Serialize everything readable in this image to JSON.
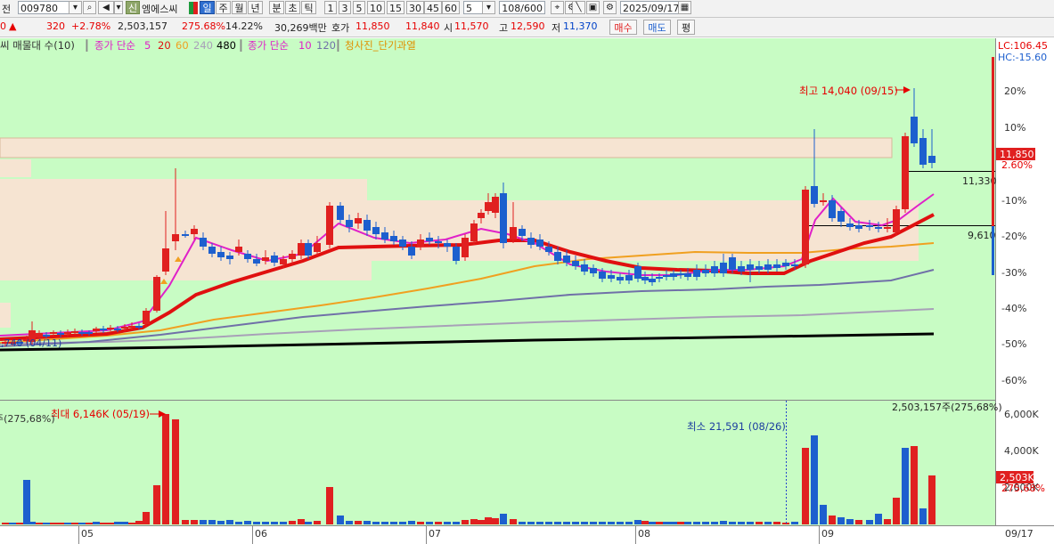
{
  "toolbar": {
    "prefix": "전",
    "code": "009780",
    "credit_badge": "신",
    "stock_name": "엠에스씨",
    "periods": [
      "일",
      "주",
      "월",
      "년",
      "분",
      "초",
      "틱"
    ],
    "selected_period": "일",
    "minute_steps": [
      "1",
      "3",
      "5",
      "10",
      "15",
      "30",
      "45",
      "60"
    ],
    "interval": "5",
    "page_counter": "108/600",
    "date": "2025/09/17"
  },
  "quote": {
    "prefix": "0",
    "down_arrow": "▲",
    "change": "320",
    "change_pct": "+2.78%",
    "volume": "2,503,157",
    "volume_ratio": "275.68%",
    "turnover": "14.22%",
    "trade_value": "30,269백만",
    "ask_label": "호가",
    "ask": "11,850",
    "bid": "11,840",
    "open_label": "시",
    "open": "11,570",
    "high_label": "고",
    "high": "12,590",
    "low_label": "저",
    "low": "11,370",
    "buy_button": "매수",
    "sell_button": "매도",
    "flat_button": "평"
  },
  "legend": {
    "vp": "씨 매물대 수(10)",
    "price_ma_label": "종가 단순",
    "price_ma_periods": [
      "5",
      "20",
      "60",
      "240",
      "480"
    ],
    "vol_ma_label": "종가 단순",
    "vol_ma_periods": [
      "10",
      "120"
    ],
    "special": "청사진_단기과열"
  },
  "price_axis": {
    "lc": "LC:106.45",
    "hc": "HC:-15.60",
    "labels": [
      "20%",
      "10%",
      "-10%",
      "-20%",
      "-30%",
      "-40%",
      "-50%",
      "-60%"
    ],
    "current_price": "11,850",
    "current_pct": "2.60%",
    "tick_values": [
      20,
      10,
      -10,
      -20,
      -30,
      -40,
      -50,
      -60
    ]
  },
  "annotations": {
    "high": "최고 14,040 (09/15)",
    "low_left": "6,740 (04/11)",
    "line1_value": "11,330",
    "line2_value": "9,610",
    "vol_max": "최대 6,146K (05/19)",
    "vol_min": "최소 21,591 (08/26)",
    "vol_total": "2,503,157주(275,68%)",
    "vol_left": "주(275,68%)"
  },
  "volume_axis": {
    "labels": [
      "6,000K",
      "4,000K",
      "2,000K"
    ],
    "current": "2,503K",
    "current_pct": "275,68%"
  },
  "x_axis": {
    "months": [
      "05",
      "06",
      "07",
      "08",
      "09"
    ],
    "current_date": "09/17"
  },
  "colors": {
    "up": "#e02020",
    "down": "#1d5fce",
    "bg": "#c8fcc4",
    "ma5": "#e020c8",
    "ma20": "#e01010",
    "ma60": "#f0a020",
    "ma240": "#7070a8",
    "ma480": "#000000",
    "vp_band": "#f6e4d2"
  },
  "chart_data": {
    "type": "candlestick",
    "title": "",
    "x": [
      "04/11",
      "05/19",
      "08/26",
      "09/15",
      "09/17"
    ],
    "ylim_pct": [
      -65,
      25
    ],
    "series": [
      {
        "name": "",
        "values": [
          6740,
          14040,
          11850
        ]
      }
    ],
    "volume_markers": {
      "max": 6146000,
      "min": 21591,
      "current": 2503157
    },
    "reference_lines": [
      11330,
      9610
    ]
  }
}
